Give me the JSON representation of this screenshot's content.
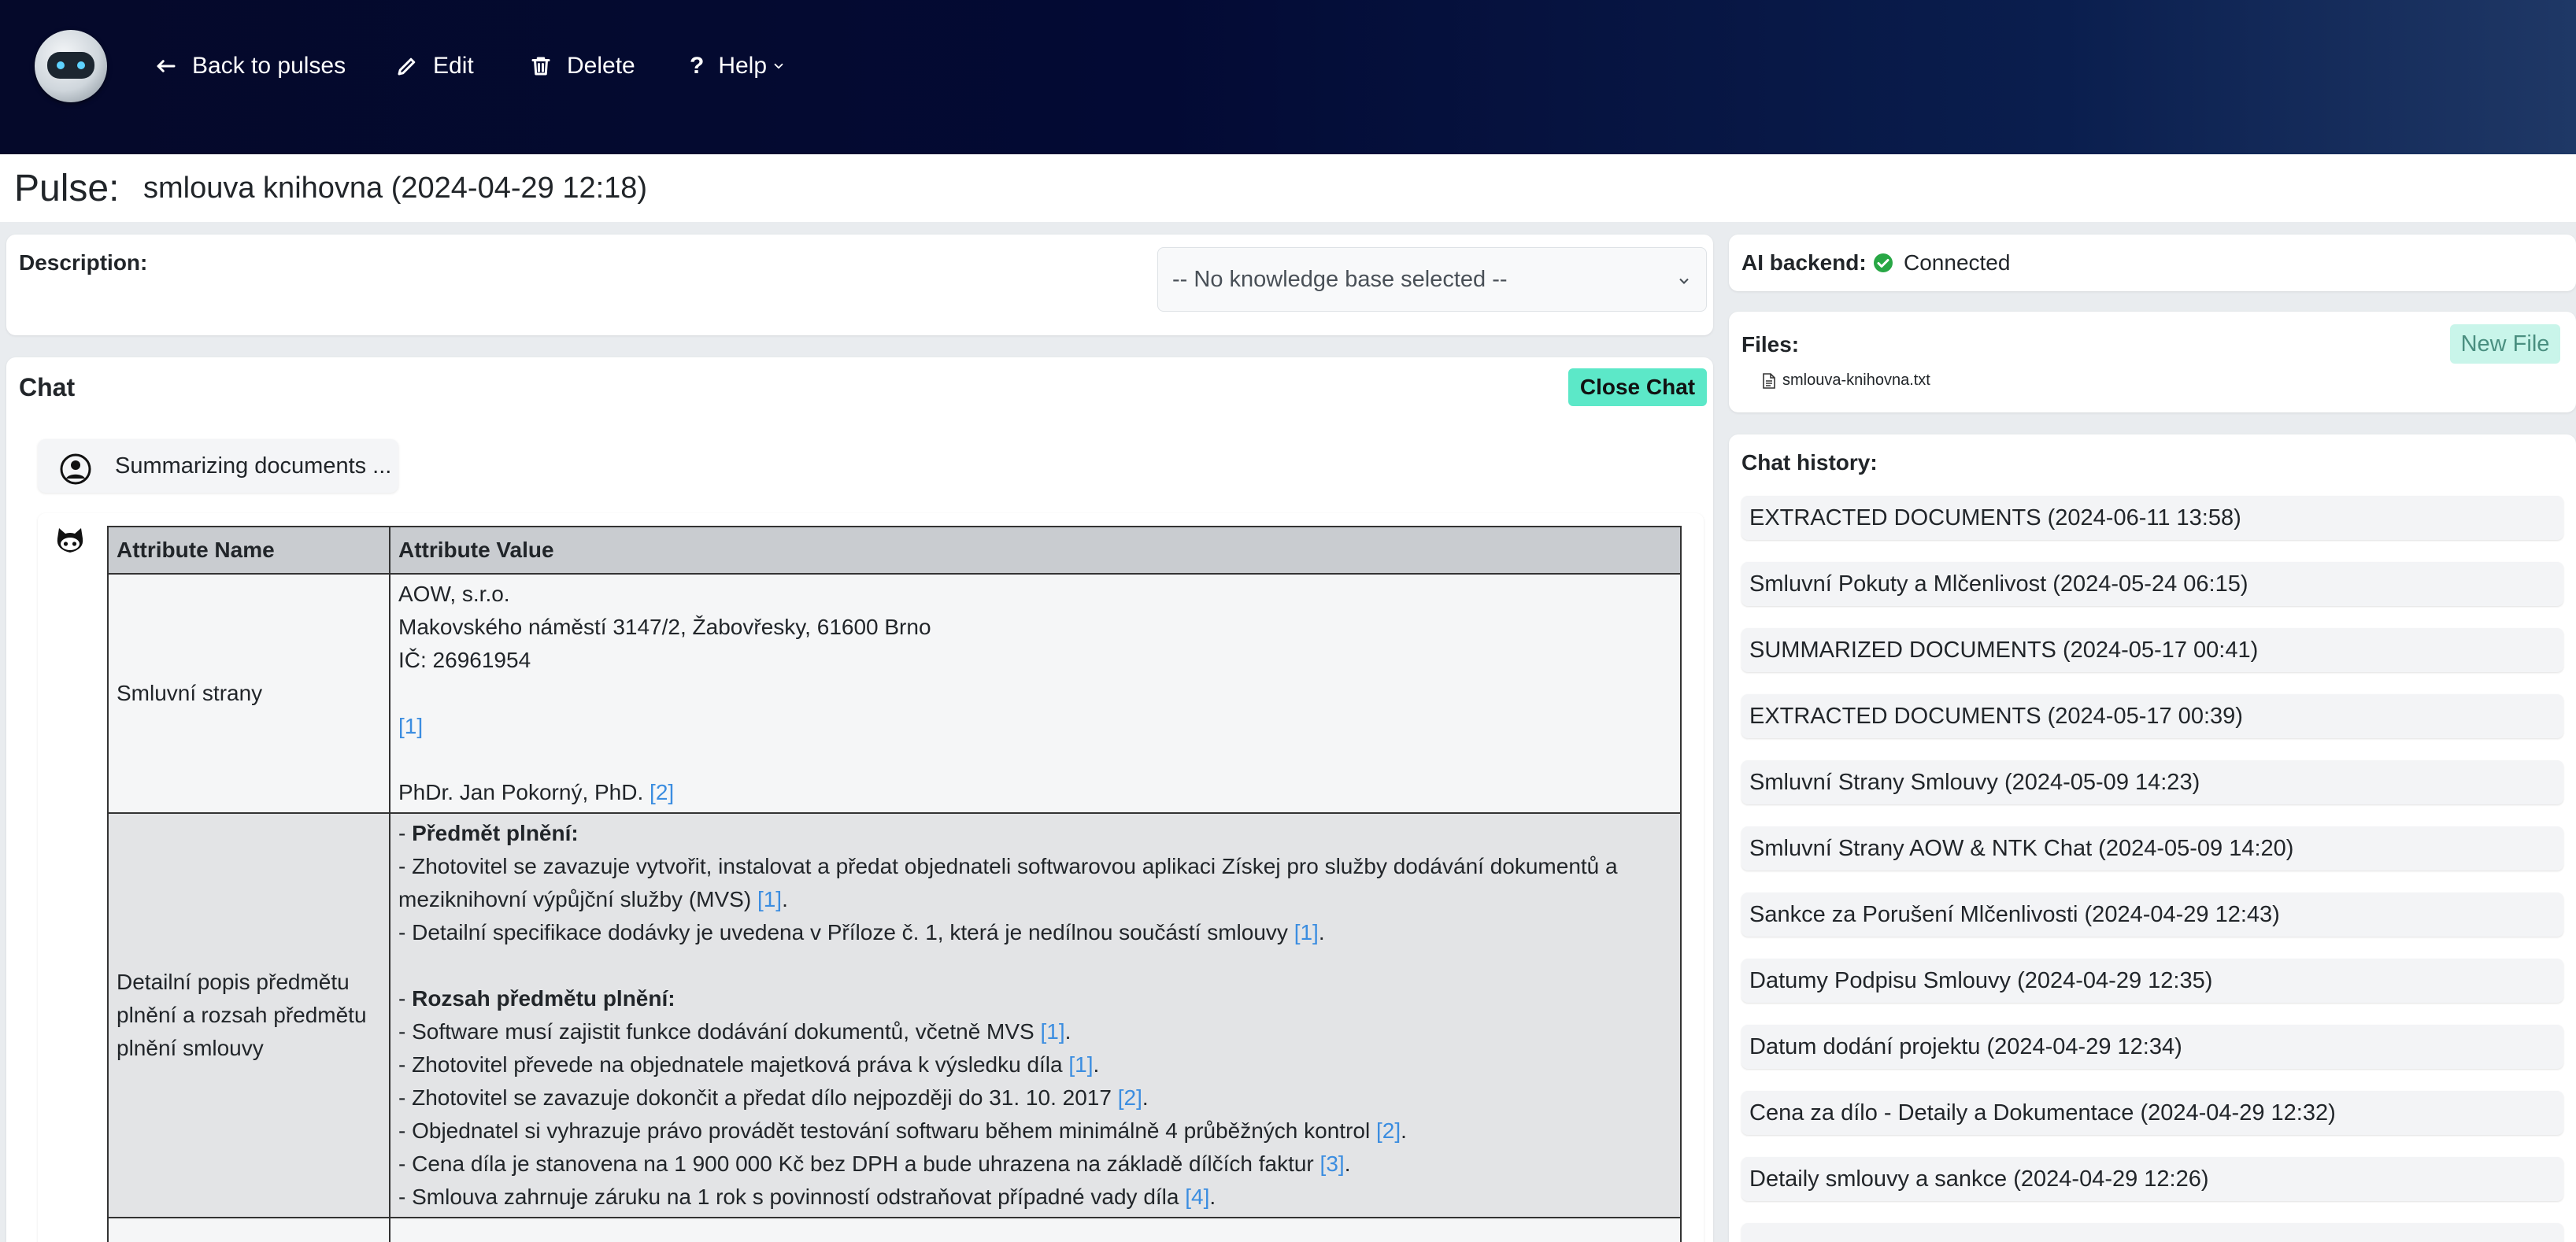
{
  "nav": {
    "back_label": "Back to pulses",
    "edit_label": "Edit",
    "delete_label": "Delete",
    "help_label": "Help"
  },
  "pulse": {
    "label": "Pulse:",
    "title": "smlouva knihovna (2024-04-29 12:18)"
  },
  "description": {
    "label": "Description:",
    "kb_select_value": "-- No knowledge base selected --"
  },
  "chat": {
    "title": "Chat",
    "close_label": "Close Chat",
    "user_message": "Summarizing documents ...",
    "table": {
      "headers": [
        "Attribute Name",
        "Attribute Value"
      ],
      "row1": {
        "name": "Smluvní strany",
        "lines": [
          "AOW, s.r.o.",
          "Makovského náměstí 3147/2, Žabovřesky, 61600 Brno",
          "IČ: 26961954",
          "[1]",
          "PhDr. Jan Pokorný, PhD.",
          "[2]"
        ]
      },
      "row2": {
        "name": "Detailní popis předmětu plnění a rozsah předmětu plnění smlouvy",
        "h1": "Předmět plnění:",
        "l1": "- Zhotovitel se zavazuje vytvořit, instalovat a předat objednateli softwarovou aplikaci Získej pro služby dodávání dokumentů a meziknihovní výpůjční služby (MVS)",
        "l1ref": "[1]",
        "l2": "- Detailní specifikace dodávky je uvedena v Příloze č. 1, která je nedílnou součástí smlouvy",
        "l2ref": "[1]",
        "h2": "Rozsah předmětu plnění:",
        "l3": "- Software musí zajistit funkce dodávání dokumentů, včetně MVS",
        "l3ref": "[1]",
        "l4": "- Zhotovitel převede na objednatele majetková práva k výsledku díla",
        "l4ref": "[1]",
        "l5": "- Zhotovitel se zavazuje dokončit a předat dílo nejpozději do 31. 10. 2017",
        "l5ref": "[2]",
        "l6": "- Objednatel si vyhrazuje právo provádět testování softwaru během minimálně 4 průběžných kontrol",
        "l6ref": "[2]",
        "l7": "- Cena díla je stanovena na 1 900 000 Kč bez DPH a bude uhrazena na základě dílčích faktur",
        "l7ref": "[3]",
        "l8": "- Smlouva zahrnuje záruku na 1 rok s povinností odstraňovat případné vady díla",
        "l8ref": "[4]"
      }
    }
  },
  "backend": {
    "label": "AI backend:",
    "status": "Connected",
    "status_color": "#28a745"
  },
  "files": {
    "label": "Files:",
    "new_label": "New File",
    "items": [
      "smlouva-knihovna.txt"
    ]
  },
  "history": {
    "label": "Chat history:",
    "items": [
      "EXTRACTED DOCUMENTS (2024-06-11 13:58)",
      "Smluvní Pokuty a Mlčenlivost (2024-05-24 06:15)",
      "SUMMARIZED DOCUMENTS (2024-05-17 00:41)",
      "EXTRACTED DOCUMENTS (2024-05-17 00:39)",
      "Smluvní Strany Smlouvy (2024-05-09 14:23)",
      "Smluvní Strany AOW & NTK Chat (2024-05-09 14:20)",
      "Sankce za Porušení Mlčenlivosti (2024-04-29 12:43)",
      "Datumy Podpisu Smlouvy (2024-04-29 12:35)",
      "Datum dodání projektu (2024-04-29 12:34)",
      "Cena za dílo - Detaily a Dokumentace (2024-04-29 12:32)",
      "Detaily smlouvy a sankce (2024-04-29 12:26)"
    ]
  }
}
